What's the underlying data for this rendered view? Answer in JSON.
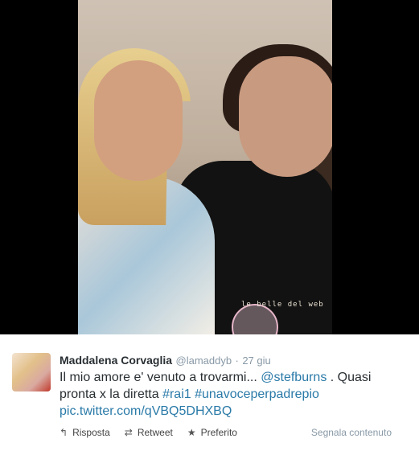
{
  "photo": {
    "watermark_text": "le belle del web"
  },
  "tweet": {
    "fullname": "Maddalena Corvaglia",
    "username": "@lamaddyb",
    "separator": "·",
    "time": "27 giu",
    "text_part1": "Il mio amore e' venuto a trovarmi...",
    "mention": "@stefburns",
    "text_part2": ". Quasi pronta x la diretta",
    "hashtag1": "#rai1",
    "hashtag2": "#unavoceperpadrepio",
    "pic_link": "pic.twitter.com/qVBQ5DHXBQ"
  },
  "actions": {
    "reply_label": "Risposta",
    "retweet_label": "Retweet",
    "favorite_label": "Preferito",
    "report_label": "Segnala contenuto"
  },
  "icons": {
    "reply": "reply-icon",
    "retweet": "retweet-icon",
    "favorite": "star-icon"
  },
  "colors": {
    "link": "#2a7aa8",
    "meta": "#8899a6",
    "text": "#292f33"
  }
}
